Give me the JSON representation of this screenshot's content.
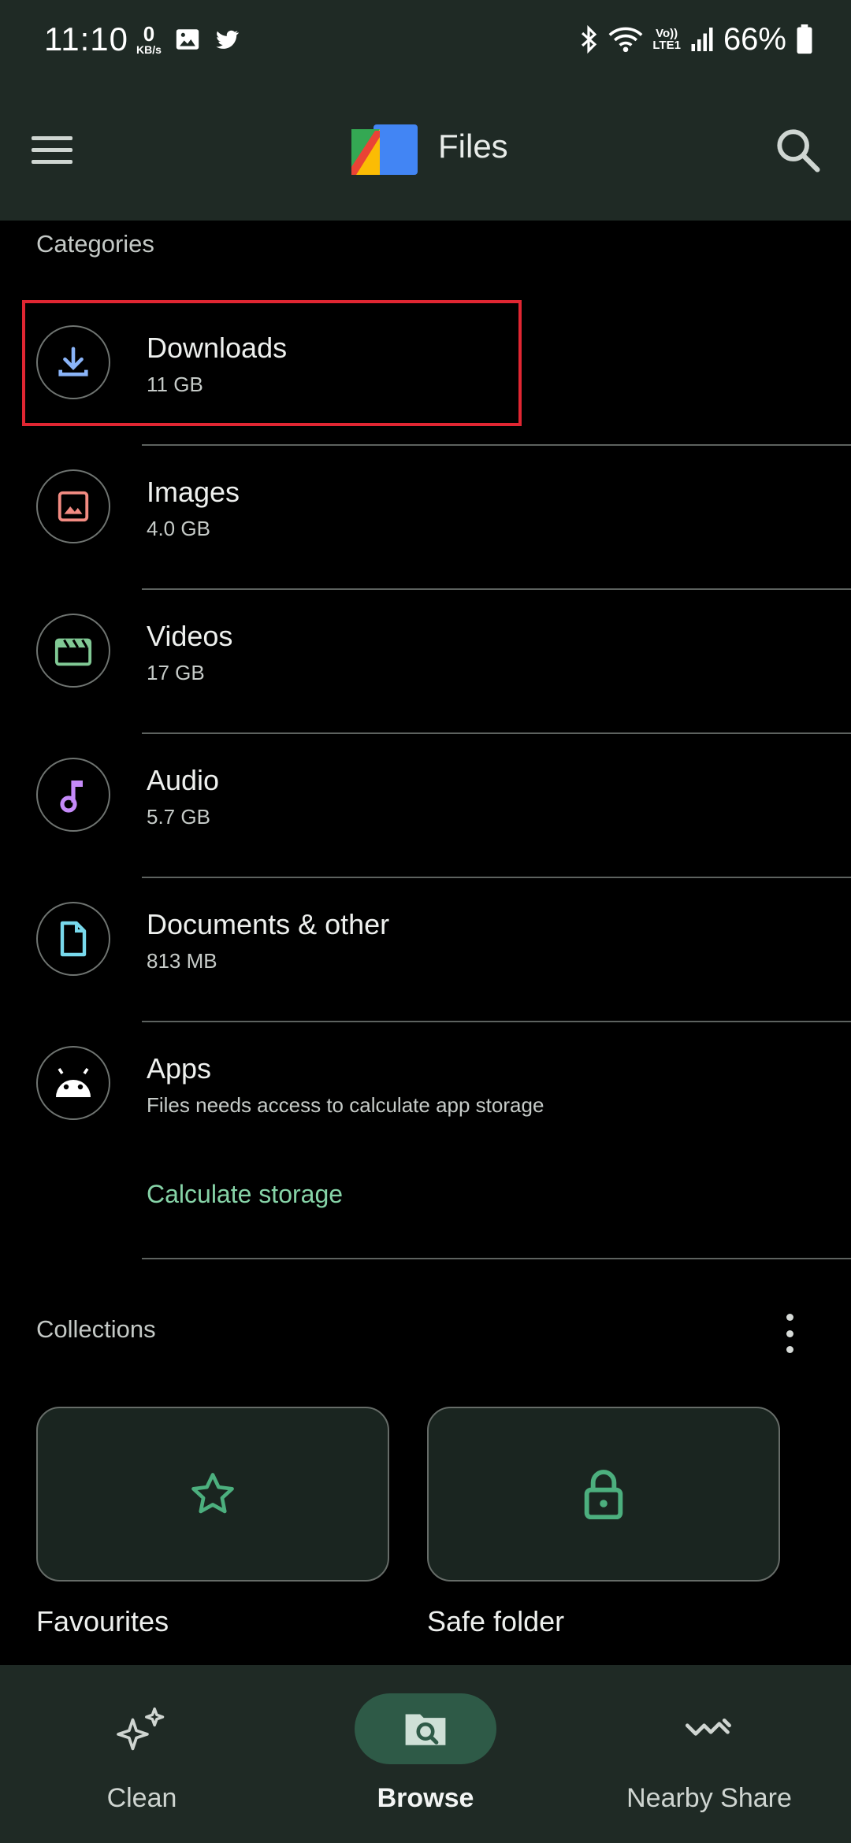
{
  "status_bar": {
    "time": "11:10",
    "net_speed_value": "0",
    "net_speed_unit": "KB/s",
    "volte_line1": "Vo))",
    "volte_line2": "LTE1",
    "battery_pct": "66%"
  },
  "app_bar": {
    "title": "Files",
    "icons": [
      "menu-icon",
      "files-logo-icon",
      "search-icon"
    ]
  },
  "categories": {
    "header": "Categories",
    "items": [
      {
        "name": "Downloads",
        "sub": "11 GB",
        "icon": "download-icon",
        "color": "#8ab4f8"
      },
      {
        "name": "Images",
        "sub": "4.0 GB",
        "icon": "image-icon",
        "color": "#f28b82"
      },
      {
        "name": "Videos",
        "sub": "17 GB",
        "icon": "video-icon",
        "color": "#81c995"
      },
      {
        "name": "Audio",
        "sub": "5.7 GB",
        "icon": "music-note-icon",
        "color": "#c58af9"
      },
      {
        "name": "Documents & other",
        "sub": "813 MB",
        "icon": "document-icon",
        "color": "#78d9ec"
      },
      {
        "name": "Apps",
        "sub": "Files needs access to calculate app storage",
        "icon": "android-icon",
        "color": "#ffffff"
      }
    ],
    "calculate_link": "Calculate storage"
  },
  "collections": {
    "header": "Collections",
    "items": [
      {
        "label": "Favourites",
        "icon": "star-icon"
      },
      {
        "label": "Safe folder",
        "icon": "lock-icon"
      }
    ]
  },
  "bottom_nav": {
    "items": [
      {
        "label": "Clean",
        "icon": "sparkle-icon",
        "active": false
      },
      {
        "label": "Browse",
        "icon": "browse-folder-icon",
        "active": true
      },
      {
        "label": "Nearby Share",
        "icon": "nearby-share-icon",
        "active": false
      }
    ]
  },
  "colors": {
    "accent_green": "#86d3a7",
    "highlight_red": "#e02632",
    "bar_background": "#1f2a25"
  }
}
